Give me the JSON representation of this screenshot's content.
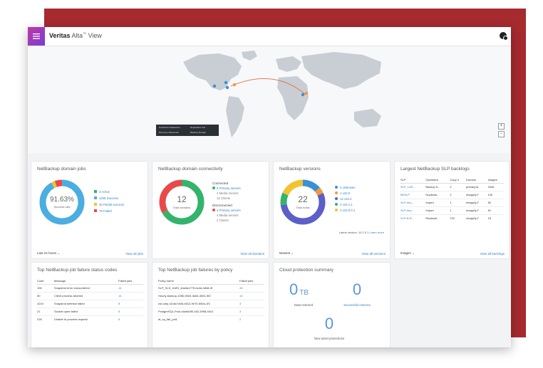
{
  "app": {
    "brand": "Veritas",
    "product": "Alta",
    "product_mark": "™",
    "view": "View"
  },
  "map": {
    "legend": [
      {
        "label": "Production Datacenter",
        "color": "#ffffff"
      },
      {
        "label": "Replication Link",
        "color": "#e8943a"
      },
      {
        "label": "Recovery Datacenter",
        "color": "#e86a3a"
      },
      {
        "label": "Backlog Storage",
        "color": "#f2c230"
      }
    ],
    "zoom_in": "+",
    "zoom_out": "−"
  },
  "jobs_card": {
    "title": "NetBackup domain jobs",
    "percent": "91.63%",
    "center_label": "Success rate",
    "legend": [
      {
        "label": "3 Active",
        "color": "#34b36a"
      },
      {
        "label": "1346 Success",
        "color": "#4aaee0"
      },
      {
        "label": "40 Partial success",
        "color": "#f2c230"
      },
      {
        "label": "79 Failed",
        "color": "#e84a4a"
      }
    ],
    "values": [
      3,
      1346,
      40,
      79
    ],
    "filter": "Last 24 hours",
    "view_all": "View all jobs"
  },
  "connectivity_card": {
    "title": "NetBackup domain connectivity",
    "count": "12",
    "center_label": "Total domains",
    "connected_heading": "Connected",
    "connected_items": [
      "8 Primary servers",
      "4 Media servers",
      "12 Clients"
    ],
    "disconnected_heading": "Disconnected",
    "disconnected_items": [
      "4 Primary servers",
      "4 Media servers",
      "2 Clients"
    ],
    "values": [
      8,
      4
    ],
    "colors": [
      "#34b36a",
      "#e84a4a"
    ],
    "view_all": "View all domains"
  },
  "versions_card": {
    "title": "NetBackup versions",
    "count": "22",
    "center_label": "Total hosts",
    "legend": [
      {
        "label": "3 Unknown",
        "color": "#3a8fd6"
      },
      {
        "label": "1 v10.0",
        "color": "#f29a3a"
      },
      {
        "label": "12 v10.2",
        "color": "#5b5fc7"
      },
      {
        "label": "2 v10.1.1",
        "color": "#34b36a"
      },
      {
        "label": "4 v10.0.0.1",
        "color": "#f2c230"
      }
    ],
    "values": [
      3,
      1,
      12,
      2,
      4
    ],
    "latest": "Latest version: 10.2.0.1",
    "learn_more": "Learn more",
    "filter": "Newest",
    "view_all": "View all versions"
  },
  "slp_card": {
    "title": "Largest NetBackup SLP backlogs",
    "headers": [
      "SLP",
      "Operation",
      "Copy n",
      "Domain",
      "Images"
    ],
    "rows": [
      [
        "SLP_LAR...",
        "Backup fr...",
        "2",
        "primary.la",
        "3446"
      ],
      [
        "BKSLP",
        "Duplicati...",
        "2",
        "nbapp2p7",
        "100"
      ],
      [
        "SLP-Imp...",
        "Import",
        "1",
        "nbapp2p7",
        "82"
      ],
      [
        "SLP-Imp...",
        "Import",
        "1",
        "nbapp2p7",
        "81"
      ],
      [
        "SLP-B-R...",
        "Replicati...",
        "102",
        "nbapp2p7",
        "15"
      ]
    ],
    "filter": "Images",
    "view_all": "View all backlogs"
  },
  "failure_codes_card": {
    "title": "Top NetBackup job failure status codes",
    "headers": [
      "Code",
      "Message",
      "Failed jobs"
    ],
    "rows": [
      [
        "196",
        "Snapshot error encountered",
        "14"
      ],
      [
        "50",
        "Client process aborted",
        "14"
      ],
      [
        "4219",
        "Snapshot deletion failed",
        "8"
      ],
      [
        "21",
        "Socket open failed",
        "8"
      ],
      [
        "226",
        "Unable to process request",
        "5"
      ]
    ]
  },
  "failure_policy_card": {
    "title": "Top NetBackup job failures by policy",
    "headers": [
      "Policy name",
      "Failed jobs"
    ],
    "rows": [
      [
        "SLP_SLS_ILMS_4da3a1775-bc4d-4848-0f",
        "49"
      ],
      [
        "Hourly-backup-1356-00e0-3a04-4061-9f2",
        "14"
      ],
      [
        "ost.carp-4116c7a06-4612-9e70-650a-1f3",
        "3"
      ],
      [
        "PostgreSQL-Pool-c6a9a3f0-182-3998-40c2",
        "3"
      ],
      [
        "at_cq_fail_pol1",
        "2"
      ]
    ]
  },
  "cloud_card": {
    "title": "Cloud protection summary",
    "data_restored_value": "0",
    "data_restored_unit": "TB",
    "data_restored_label": "Data restored",
    "restores_value": "0",
    "restores_label": "Successful restores",
    "new_assets_value": "0",
    "new_assets_label": "New asset protections"
  }
}
